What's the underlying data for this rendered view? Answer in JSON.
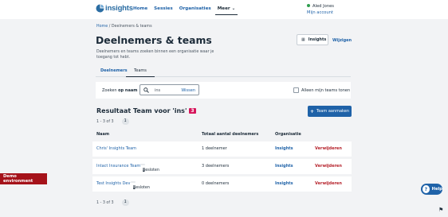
{
  "header": {
    "logo_text": "insights",
    "nav": [
      "Home",
      "Sessies",
      "Organisaties"
    ],
    "more_label": "Meer",
    "user_name": "Aled Jones",
    "account_link": "Mijn account",
    "status_color": "#2f9e4e"
  },
  "breadcrumb": [
    "Home",
    "Deelnemers & teams"
  ],
  "page": {
    "title": "Deelnemers & teams",
    "description": "Deelnemers en teams zoeken binnen een organisatie waar je toegang tot hebt.",
    "insights_button": "Insights",
    "change_link": "Wijzigen"
  },
  "tabs": [
    "Deelnemers",
    "Teams"
  ],
  "search": {
    "label_prefix": "Zoeken",
    "label_suffix": "op naam",
    "value": "ins",
    "clear_label": "Wissen",
    "only_my_teams_label": "Alleen mijn teams tonen",
    "only_my_teams_checked": false
  },
  "results": {
    "title": "Resultaat Team voor 'ins'",
    "count": "3",
    "add_button": "Team aanmaken",
    "pagination_text": "1 - 3 of 3",
    "current_page": "1"
  },
  "table": {
    "headers": [
      "Naam",
      "Totaal aantal deelnemers",
      "Organisatie",
      ""
    ],
    "rows": [
      {
        "name": "Chris' Insights Team",
        "badge": "",
        "members": "1 deelnemer",
        "org": "Insights",
        "action": "Verwijderen"
      },
      {
        "name": "Intact Insurance Team",
        "badge": "Besloten",
        "members": "3 deelnemers",
        "org": "Insights",
        "action": "Verwijderen"
      },
      {
        "name": "Test Insights Dev",
        "badge": "Besloten",
        "members": "0 deelnemers",
        "org": "Insights",
        "action": "Verwijderen"
      }
    ]
  },
  "demo_label": "Demo environment",
  "help_label": "Help",
  "colors": {
    "brand": "#1f62a8",
    "danger": "#b6232c",
    "count_badge": "#d6155b",
    "demo": "#a5121a"
  }
}
